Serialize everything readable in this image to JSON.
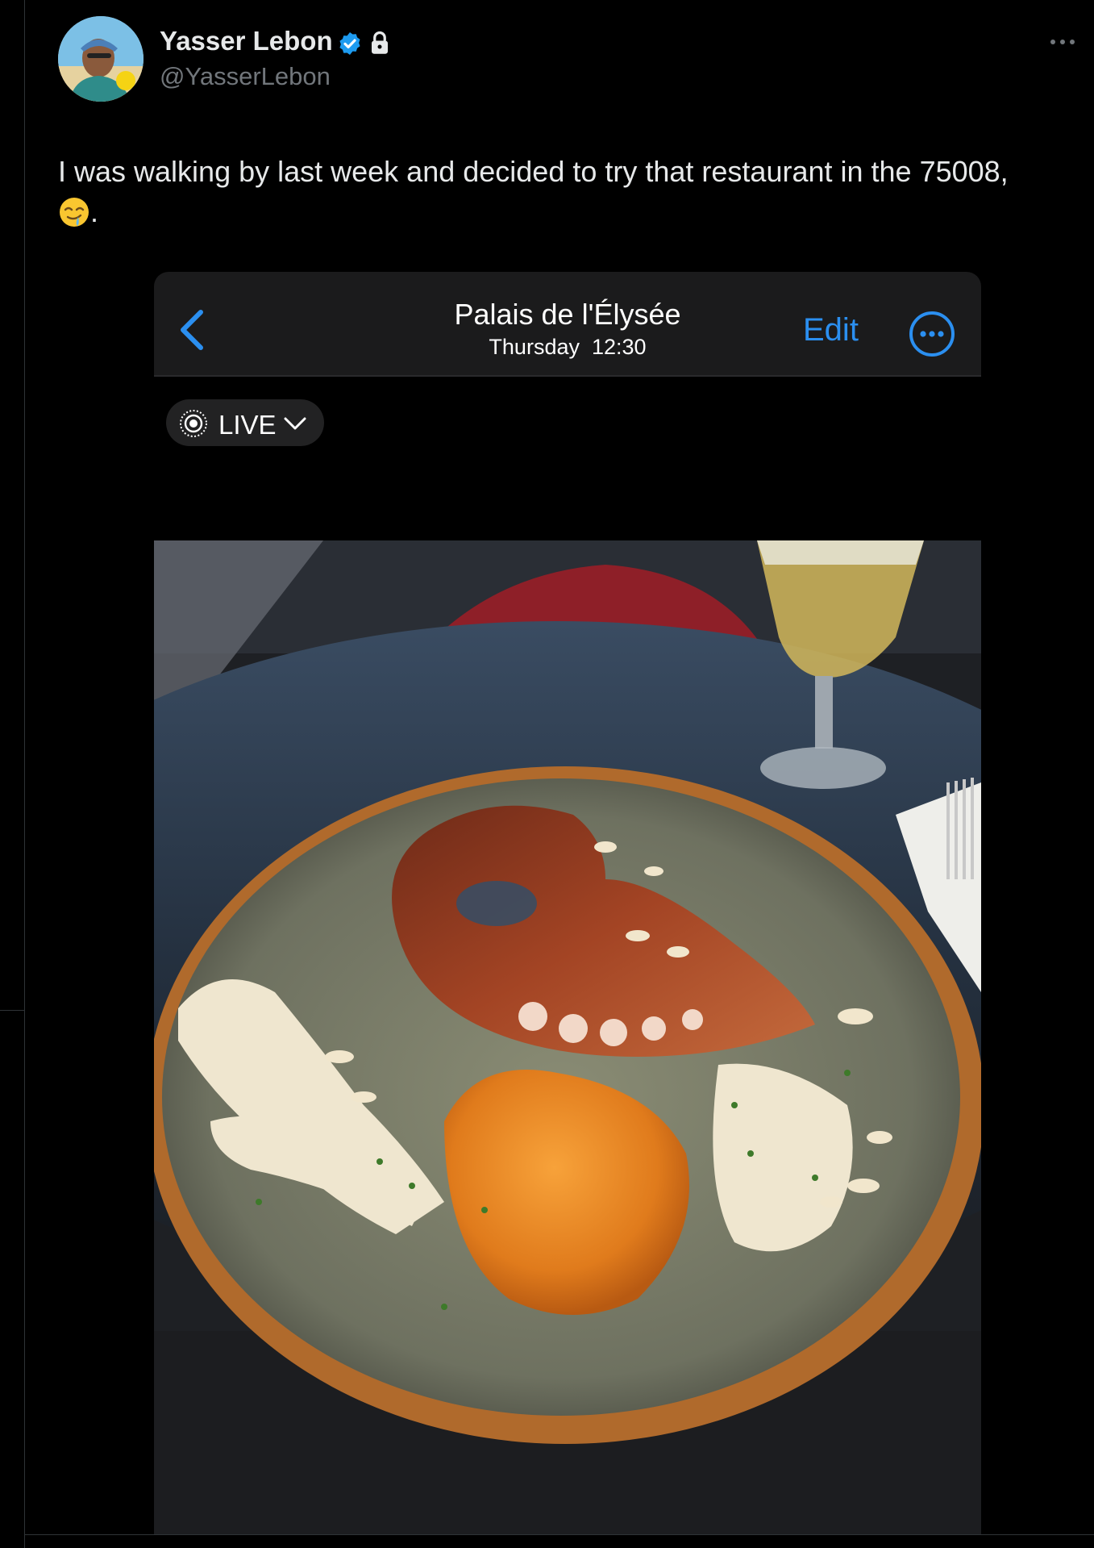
{
  "tweet": {
    "display_name": "Yasser Lebon",
    "handle": "@YasserLebon",
    "text_main": "I was walking by last week and decided to try that restaurant in the 75008,",
    "text_end": ".",
    "emoji": "drooling-face-emoji",
    "icons": [
      "verified-badge-icon",
      "lock-icon",
      "more-options-icon"
    ]
  },
  "photo_viewer": {
    "title": "Palais de l'Élysée",
    "day": "Thursday",
    "time": "12:30",
    "edit_label": "Edit",
    "live_label": "LIVE",
    "icons": [
      "back-chevron-icon",
      "more-circle-icon",
      "live-photo-icon",
      "chevron-down-icon"
    ]
  },
  "colors": {
    "background": "#000000",
    "text": "#e7e9ea",
    "secondary_text": "#71767b",
    "verified_blue": "#1d9bf0",
    "ios_blue": "#2b8ff0"
  }
}
